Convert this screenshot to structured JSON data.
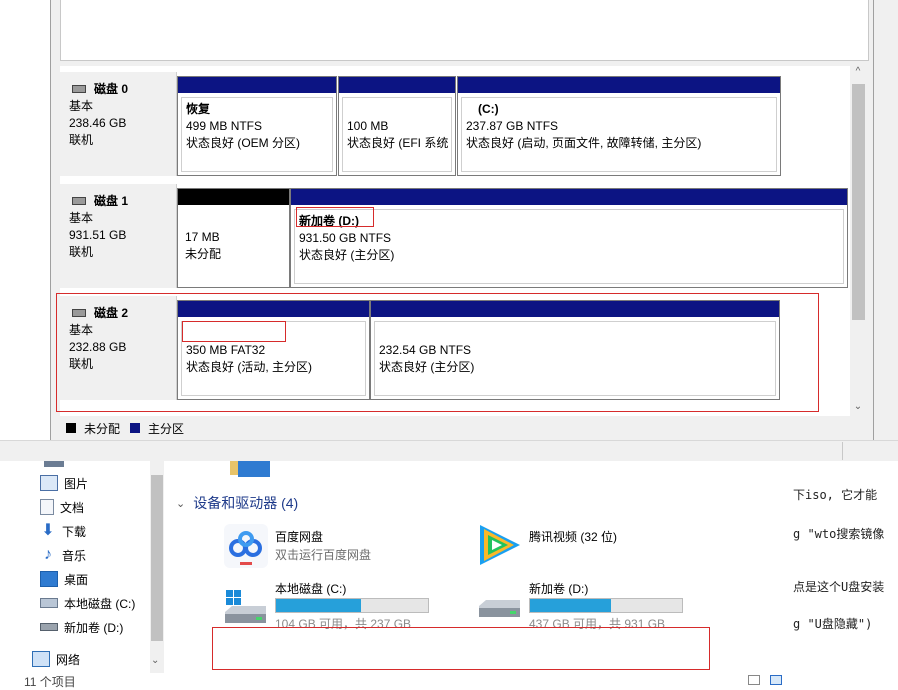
{
  "disk_mgmt": {
    "disks": [
      {
        "name": "磁盘 0",
        "type": "基本",
        "size": "238.46 GB",
        "status": "联机",
        "partitions": [
          {
            "name": "恢复",
            "size_fs": "499 MB NTFS",
            "status": "状态良好 (OEM 分区)"
          },
          {
            "name": "",
            "size_fs": "100 MB",
            "status": "状态良好 (EFI 系统"
          },
          {
            "name": "(C:)",
            "size_fs": "237.87 GB NTFS",
            "status": "状态良好 (启动, 页面文件, 故障转储, 主分区)"
          }
        ]
      },
      {
        "name": "磁盘 1",
        "type": "基本",
        "size": "931.51 GB",
        "status": "联机",
        "partitions": [
          {
            "name": "",
            "size_fs": "17 MB",
            "status": "未分配"
          },
          {
            "name": "新加卷  (D:)",
            "size_fs": "931.50 GB NTFS",
            "status": "状态良好 (主分区)"
          }
        ]
      },
      {
        "name": "磁盘 2",
        "type": "基本",
        "size": "232.88 GB",
        "status": "联机",
        "partitions": [
          {
            "name": "",
            "size_fs": "350 MB FAT32",
            "status": "状态良好 (活动, 主分区)"
          },
          {
            "name": "",
            "size_fs": "232.54 GB NTFS",
            "status": "状态良好 (主分区)"
          }
        ]
      }
    ],
    "legend": {
      "unallocated": "未分配",
      "primary": "主分区"
    },
    "scroll_up": "^",
    "scroll_down": "⌄",
    "colors": {
      "primary_bar": "#0c1483",
      "unallocated_bar": "#000000",
      "highlight": "#d62b2b"
    }
  },
  "explorer": {
    "nav": [
      {
        "label": "图片",
        "icon": "pictures-icon"
      },
      {
        "label": "文档",
        "icon": "documents-icon"
      },
      {
        "label": "下载",
        "icon": "download-icon"
      },
      {
        "label": "音乐",
        "icon": "music-icon"
      },
      {
        "label": "桌面",
        "icon": "desktop-icon"
      },
      {
        "label": "本地磁盘 (C:)",
        "icon": "drive-icon"
      },
      {
        "label": "新加卷 (D:)",
        "icon": "drive-icon"
      }
    ],
    "network": "网络",
    "item_count": "11 个项目",
    "section_title": "设备和驱动器 (4)",
    "devices": [
      {
        "name": "百度网盘",
        "sub": "双击运行百度网盘",
        "icon": "baidu-netdisk-icon"
      },
      {
        "name": "腾讯视频 (32 位)",
        "sub": "",
        "icon": "tencent-video-icon"
      }
    ],
    "drives": [
      {
        "name": "本地磁盘 (C:)",
        "free": "104 GB 可用，共 237 GB",
        "used_fraction": 0.56
      },
      {
        "name": "新加卷 (D:)",
        "free": "437 GB 可用，共 931 GB",
        "used_fraction": 0.53
      }
    ]
  },
  "background_text": {
    "line1": "下iso, 它才能",
    "line2": "g \"wto搜索镜像",
    "line3": "点是这个U盘安装",
    "line4": "g \"U盘隐藏\")"
  }
}
